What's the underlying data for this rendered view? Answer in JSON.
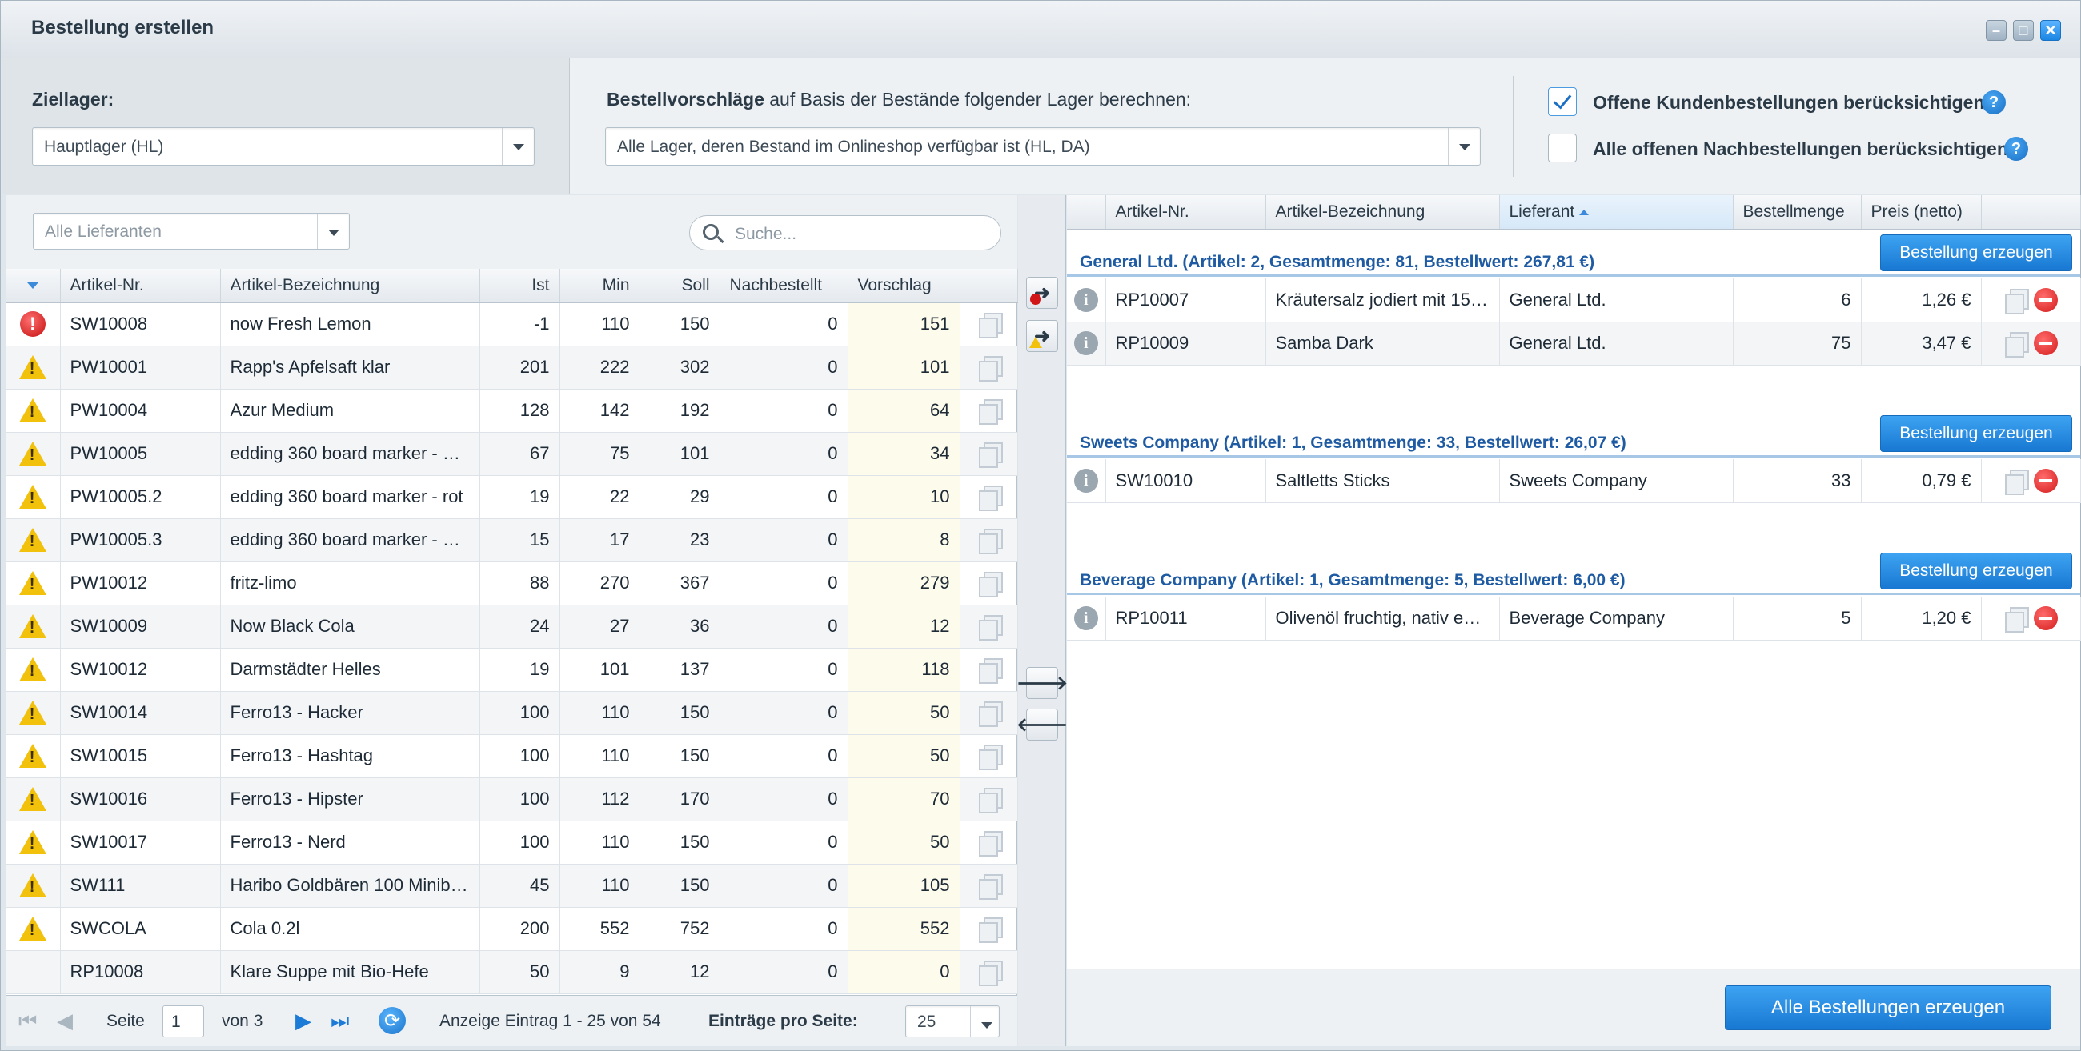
{
  "window": {
    "title": "Bestellung erstellen"
  },
  "top": {
    "target_label": "Ziellager:",
    "target_value": "Hauptlager (HL)",
    "calc_label_bold": "Bestellvorschläge",
    "calc_label_rest": " auf Basis der Bestände folgender Lager berechnen:",
    "calc_value": "Alle Lager, deren Bestand im Onlineshop verfügbar ist (HL, DA)",
    "opt1_label": "Offene Kundenbestellungen berücksichtigen",
    "opt1_checked": true,
    "opt2_label": "Alle offenen Nachbestellungen berücksichtigen",
    "opt2_checked": false
  },
  "left": {
    "supplier_filter": "Alle Lieferanten",
    "search_placeholder": "Suche...",
    "columns": [
      "Artikel-Nr.",
      "Artikel-Bezeichnung",
      "Ist",
      "Min",
      "Soll",
      "Nachbestellt",
      "Vorschlag"
    ],
    "rows": [
      {
        "status": "error",
        "nr": "SW10008",
        "name": "now Fresh Lemon",
        "ist": "-1",
        "min": "110",
        "soll": "150",
        "nach": "0",
        "vor": "151"
      },
      {
        "status": "warning",
        "nr": "PW10001",
        "name": "Rapp's Apfelsaft klar",
        "ist": "201",
        "min": "222",
        "soll": "302",
        "nach": "0",
        "vor": "101"
      },
      {
        "status": "warning",
        "nr": "PW10004",
        "name": "Azur Medium",
        "ist": "128",
        "min": "142",
        "soll": "192",
        "nach": "0",
        "vor": "64"
      },
      {
        "status": "warning",
        "nr": "PW10005",
        "name": "edding 360 board marker - …",
        "ist": "67",
        "min": "75",
        "soll": "101",
        "nach": "0",
        "vor": "34"
      },
      {
        "status": "warning",
        "nr": "PW10005.2",
        "name": "edding 360 board marker - rot",
        "ist": "19",
        "min": "22",
        "soll": "29",
        "nach": "0",
        "vor": "10"
      },
      {
        "status": "warning",
        "nr": "PW10005.3",
        "name": "edding 360 board marker - …",
        "ist": "15",
        "min": "17",
        "soll": "23",
        "nach": "0",
        "vor": "8"
      },
      {
        "status": "warning",
        "nr": "PW10012",
        "name": "fritz-limo",
        "ist": "88",
        "min": "270",
        "soll": "367",
        "nach": "0",
        "vor": "279"
      },
      {
        "status": "warning",
        "nr": "SW10009",
        "name": "Now Black Cola",
        "ist": "24",
        "min": "27",
        "soll": "36",
        "nach": "0",
        "vor": "12"
      },
      {
        "status": "warning",
        "nr": "SW10012",
        "name": "Darmstädter Helles",
        "ist": "19",
        "min": "101",
        "soll": "137",
        "nach": "0",
        "vor": "118"
      },
      {
        "status": "warning",
        "nr": "SW10014",
        "name": "Ferro13 - Hacker",
        "ist": "100",
        "min": "110",
        "soll": "150",
        "nach": "0",
        "vor": "50"
      },
      {
        "status": "warning",
        "nr": "SW10015",
        "name": "Ferro13 - Hashtag",
        "ist": "100",
        "min": "110",
        "soll": "150",
        "nach": "0",
        "vor": "50"
      },
      {
        "status": "warning",
        "nr": "SW10016",
        "name": "Ferro13 - Hipster",
        "ist": "100",
        "min": "112",
        "soll": "170",
        "nach": "0",
        "vor": "70"
      },
      {
        "status": "warning",
        "nr": "SW10017",
        "name": "Ferro13 - Nerd",
        "ist": "100",
        "min": "110",
        "soll": "150",
        "nach": "0",
        "vor": "50"
      },
      {
        "status": "warning",
        "nr": "SW111",
        "name": "Haribo Goldbären 100 Minib…",
        "ist": "45",
        "min": "110",
        "soll": "150",
        "nach": "0",
        "vor": "105"
      },
      {
        "status": "warning",
        "nr": "SWCOLA",
        "name": "Cola 0.2l",
        "ist": "200",
        "min": "552",
        "soll": "752",
        "nach": "0",
        "vor": "552"
      },
      {
        "status": "none",
        "nr": "RP10008",
        "name": "Klare Suppe mit Bio-Hefe",
        "ist": "50",
        "min": "9",
        "soll": "12",
        "nach": "0",
        "vor": "0"
      }
    ],
    "pager": {
      "page_label": "Seite",
      "page_value": "1",
      "of_label": "von 3",
      "display_text": "Anzeige Eintrag 1 - 25 von 54",
      "per_page_label": "Einträge pro Seite:",
      "per_page_value": "25"
    }
  },
  "right": {
    "columns": [
      "Artikel-Nr.",
      "Artikel-Bezeichnung",
      "Lieferant",
      "Bestellmenge",
      "Preis (netto)"
    ],
    "create_label": "Bestellung erzeugen",
    "groups": [
      {
        "title": "General Ltd. (Artikel: 2, Gesamtmenge: 81, Bestellwert: 267,81 €)",
        "rows": [
          {
            "nr": "RP10007",
            "name": "Kräutersalz jodiert mit 15…",
            "supplier": "General Ltd.",
            "qty": "6",
            "price": "1,26 €"
          },
          {
            "nr": "RP10009",
            "name": "Samba Dark",
            "supplier": "General Ltd.",
            "qty": "75",
            "price": "3,47 €"
          }
        ]
      },
      {
        "title": "Sweets Company (Artikel: 1, Gesamtmenge: 33, Bestellwert: 26,07 €)",
        "rows": [
          {
            "nr": "SW10010",
            "name": "Saltletts Sticks",
            "supplier": "Sweets Company",
            "qty": "33",
            "price": "0,79 €"
          }
        ]
      },
      {
        "title": "Beverage Company (Artikel: 1, Gesamtmenge: 5, Bestellwert: 6,00 €)",
        "rows": [
          {
            "nr": "RP10011",
            "name": "Olivenöl fruchtig, nativ e…",
            "supplier": "Beverage Company",
            "qty": "5",
            "price": "1,20 €"
          }
        ]
      }
    ],
    "create_all_label": "Alle Bestellungen erzeugen"
  },
  "colors": {
    "accent": "#1878d2",
    "group_title": "#1f5ba3",
    "suggestion_bg": "#fdfbec",
    "warning": "#f2c10c",
    "error": "#c40f0f"
  }
}
